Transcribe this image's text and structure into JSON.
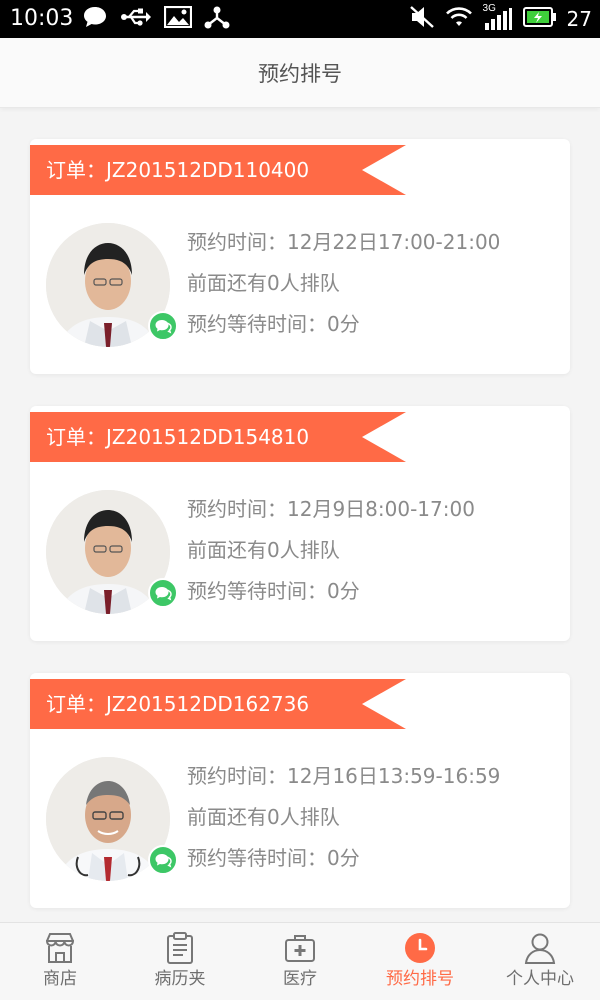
{
  "status_bar": {
    "time": "10:03",
    "battery_level": "27",
    "network_label": "3G"
  },
  "header": {
    "title": "预约排号"
  },
  "orders": [
    {
      "order_label": "订单：JZ201512DD110400",
      "appointment_time": "预约时间：12月22日17:00-21:00",
      "queue_ahead": "前面还有0人排队",
      "wait_time": "预约等待时间：0分"
    },
    {
      "order_label": "订单：JZ201512DD154810",
      "appointment_time": "预约时间：12月9日8:00-17:00",
      "queue_ahead": "前面还有0人排队",
      "wait_time": "预约等待时间：0分"
    },
    {
      "order_label": "订单：JZ201512DD162736",
      "appointment_time": "预约时间：12月16日13:59-16:59",
      "queue_ahead": "前面还有0人排队",
      "wait_time": "预约等待时间：0分"
    }
  ],
  "tab_bar": {
    "tabs": [
      {
        "label": "商店",
        "icon": "store-icon",
        "active": false
      },
      {
        "label": "病历夹",
        "icon": "clipboard-icon",
        "active": false
      },
      {
        "label": "医疗",
        "icon": "medical-kit-icon",
        "active": false
      },
      {
        "label": "预约排号",
        "icon": "clock-icon",
        "active": true
      },
      {
        "label": "个人中心",
        "icon": "person-icon",
        "active": false
      }
    ]
  },
  "colors": {
    "accent": "#ff6a46",
    "chat_badge": "#3dc766",
    "text_secondary": "#8a8a8a"
  }
}
